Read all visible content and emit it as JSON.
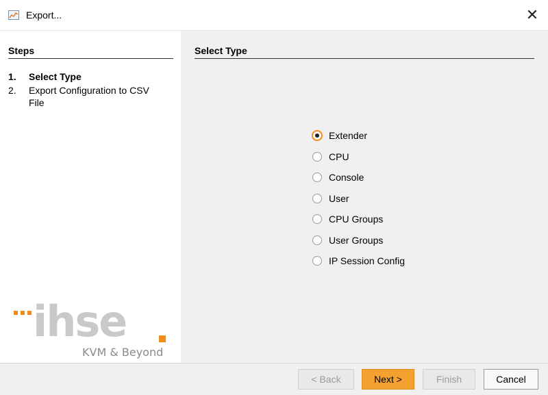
{
  "window": {
    "title": "Export...",
    "close_glyph": "✕",
    "app_icon": "chart-icon"
  },
  "steps": {
    "heading": "Steps",
    "items": [
      {
        "num": "1.",
        "label": "Select Type"
      },
      {
        "num": "2.",
        "label": "Export Configuration to CSV File"
      }
    ]
  },
  "logo": {
    "word": "ihse",
    "tagline": "KVM & Beyond",
    "accent_color": "#f28c18"
  },
  "main": {
    "heading": "Select Type",
    "options": [
      {
        "label": "Extender",
        "checked": true
      },
      {
        "label": "CPU",
        "checked": false
      },
      {
        "label": "Console",
        "checked": false
      },
      {
        "label": "User",
        "checked": false
      },
      {
        "label": "CPU Groups",
        "checked": false
      },
      {
        "label": "User Groups",
        "checked": false
      },
      {
        "label": "IP Session Config",
        "checked": false
      }
    ]
  },
  "footer": {
    "back_label": "< Back",
    "next_label": "Next >",
    "finish_label": "Finish",
    "cancel_label": "Cancel"
  },
  "colors": {
    "accent": "#f28c18",
    "primary_button": "#f5a132",
    "panel_bg": "#f0f0f0"
  }
}
